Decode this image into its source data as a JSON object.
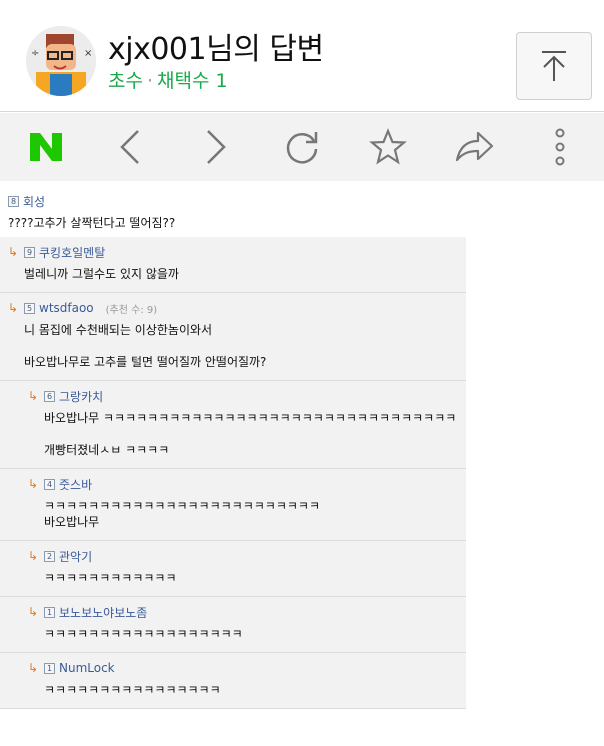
{
  "header": {
    "title": "xjx001님의 답변",
    "grade": "초수",
    "separator": "·",
    "adopt_label": "채택수",
    "adopt_count": "1"
  },
  "toolbar": {
    "icons": [
      "naver-logo-icon",
      "back-icon",
      "forward-icon",
      "refresh-icon",
      "star-icon",
      "share-icon",
      "more-icon"
    ],
    "naver_color": "#1ec800"
  },
  "root_comment": {
    "level": "8",
    "author": "회성",
    "text": "????고추가 살짝턴다고 떨어짐??"
  },
  "replies": [
    {
      "level": "9",
      "author": "쿠킹호일멘탈",
      "recommend": "",
      "lines": [
        "벌레니까 그럴수도 있지 않을까"
      ]
    },
    {
      "level": "5",
      "author": "wtsdfaoo",
      "recommend": "(추천 수: 9)",
      "lines": [
        "니 몸집에 수천배되는 이상한놈이와서",
        "",
        "바오밥나무로 고추를 털면 떨어질까 안떨어질까?"
      ]
    },
    {
      "level": "6",
      "author": "그랑카치",
      "recommend": "",
      "lines": [
        "바오밥나무 ㅋㅋㅋㅋㅋㅋㅋㅋㅋㅋㅋㅋㅋㅋㅋㅋㅋㅋㅋㅋㅋㅋㅋㅋㅋㅋㅋㅋㅋㅋㅋㅋ",
        "",
        "개빵터졌네ㅅㅂ ㅋㅋㅋㅋ"
      ]
    },
    {
      "level": "4",
      "author": "줏스바",
      "recommend": "",
      "lines": [
        "ㅋㅋㅋㅋㅋㅋㅋㅋㅋㅋㅋㅋㅋㅋㅋㅋㅋㅋㅋㅋㅋㅋㅋㅋㅋ",
        "바오밥나무"
      ]
    },
    {
      "level": "2",
      "author": "관악기",
      "recommend": "",
      "lines": [
        "ㅋㅋㅋㅋㅋㅋㅋㅋㅋㅋㅋㅋ"
      ]
    },
    {
      "level": "1",
      "author": "보노보노야보노좀",
      "recommend": "",
      "lines": [
        "ㅋㅋㅋㅋㅋㅋㅋㅋㅋㅋㅋㅋㅋㅋㅋㅋㅋㅋ"
      ]
    },
    {
      "level": "1",
      "author": "NumLock",
      "recommend": "",
      "lines": [
        "ㅋㅋㅋㅋㅋㅋㅋㅋㅋㅋㅋㅋㅋㅋㅋㅋ"
      ]
    }
  ]
}
